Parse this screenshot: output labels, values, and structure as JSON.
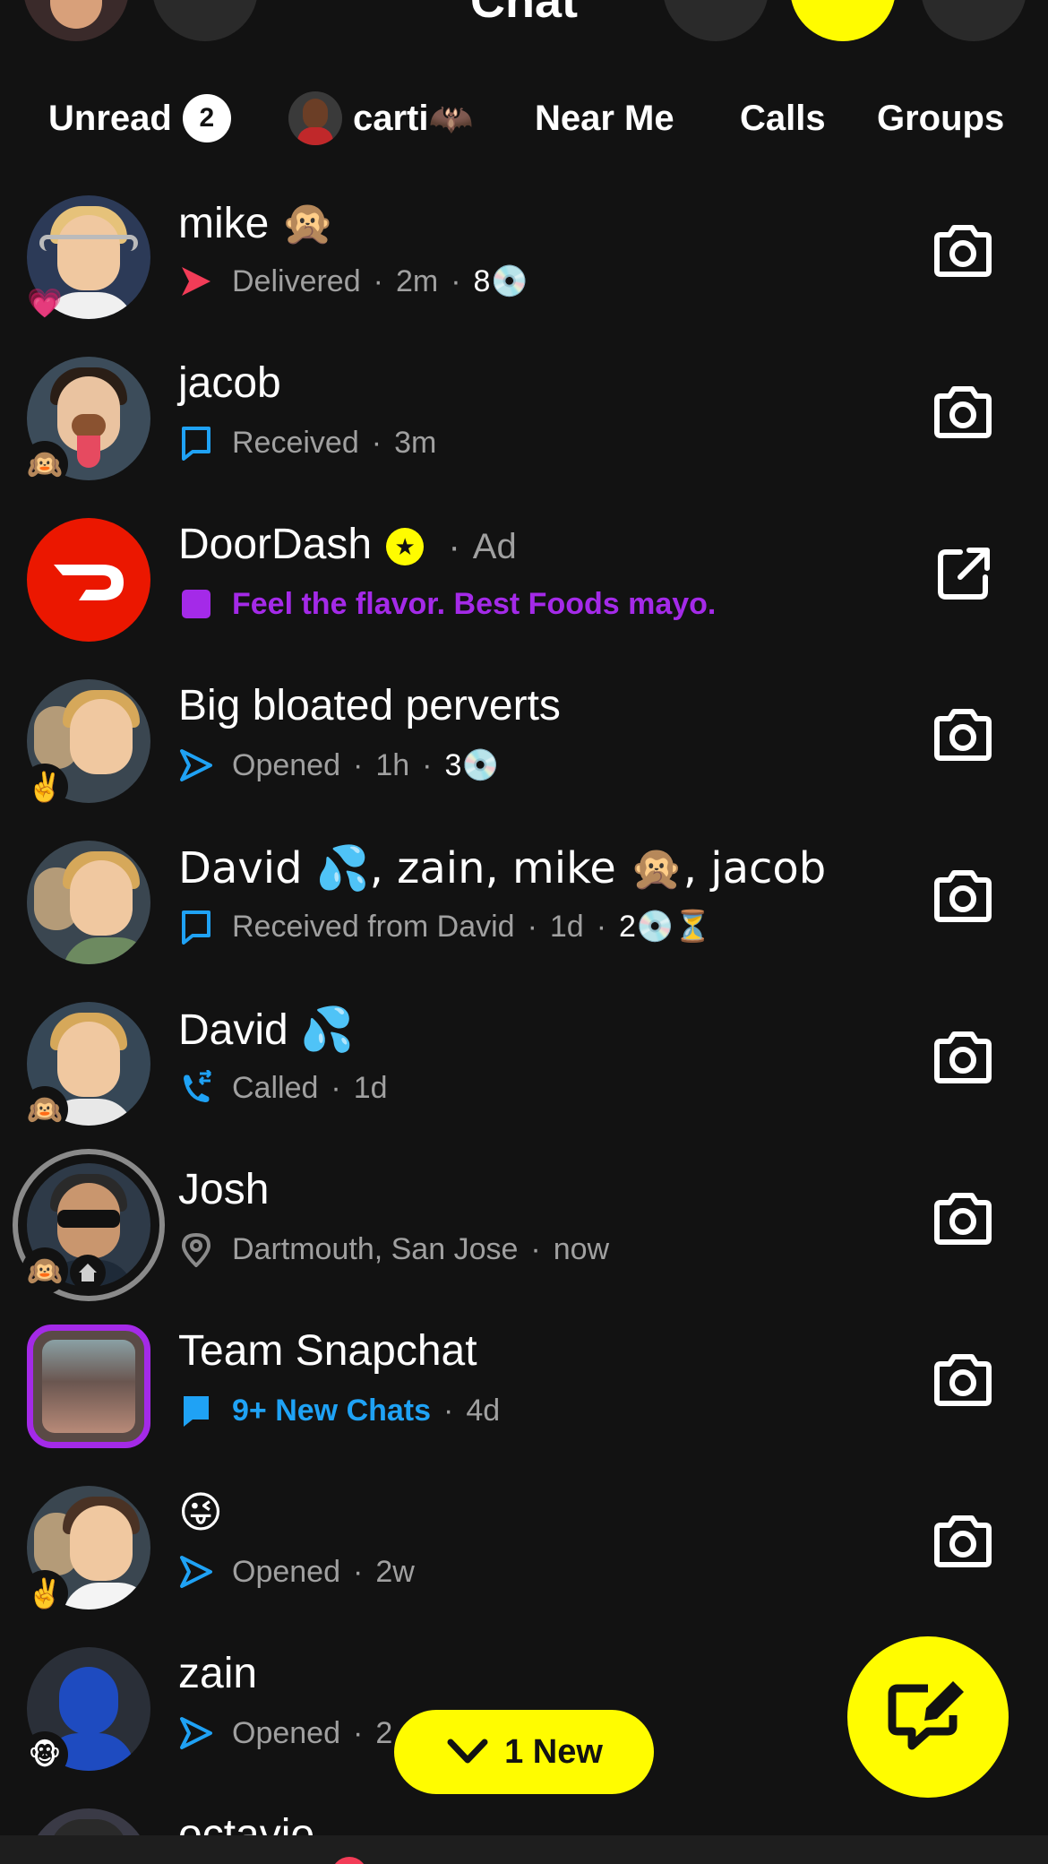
{
  "header": {
    "title": "Chat"
  },
  "tabs": [
    {
      "label": "Unread",
      "badge": "2"
    },
    {
      "label": "carti",
      "emoji": "🦇"
    },
    {
      "label": "Near Me"
    },
    {
      "label": "Calls"
    },
    {
      "label": "Groups"
    }
  ],
  "chats": [
    {
      "name": "mike",
      "name_emoji": "🙊",
      "sub_emoji": "💗",
      "status_icon": "delivered-arrow-icon",
      "status": "Delivered",
      "time": "2m",
      "streak": "8",
      "streak_emoji": "💿"
    },
    {
      "name": "jacob",
      "sub_emoji": "🙉",
      "status_icon": "received-chat-icon",
      "status": "Received",
      "time": "3m"
    },
    {
      "name": "DoorDash",
      "ad_label": "Ad",
      "status_icon": "ad-square-icon",
      "status": "Feel the flavor. Best Foods mayo."
    },
    {
      "name": "Big bloated perverts",
      "sub_emoji": "✌️",
      "status_icon": "opened-arrow-icon",
      "status": "Opened",
      "time": "1h",
      "streak": "3",
      "streak_emoji": "💿"
    },
    {
      "name": "David 💦, zain, mike 🙊, jacob",
      "status_icon": "received-chat-icon",
      "status": "Received from David",
      "time": "1d",
      "streak": "2",
      "streak_emoji": "💿⏳"
    },
    {
      "name": "David",
      "name_emoji": "💦",
      "sub_emoji": "🙉",
      "status_icon": "call-icon",
      "status": "Called",
      "time": "1d"
    },
    {
      "name": "Josh",
      "sub_emoji": "🙉",
      "status_icon": "location-pin-icon",
      "status": "Dartmouth, San Jose",
      "time": "now"
    },
    {
      "name": "Team Snapchat",
      "status_icon": "new-chat-filled-icon",
      "status": "9+ New Chats",
      "time": "4d"
    },
    {
      "name": "😜",
      "sub_emoji": "✌️",
      "status_icon": "opened-arrow-icon",
      "status": "Opened",
      "time": "2w"
    },
    {
      "name": "zain",
      "sub_emoji": "🐵",
      "status_icon": "opened-arrow-icon",
      "status": "Opened",
      "time": "2"
    },
    {
      "name": "octavio"
    }
  ],
  "new_pill": {
    "label": "1 New"
  },
  "colors": {
    "background": "#121212",
    "snap_yellow": "#fffc00",
    "sent_red": "#f23c57",
    "chat_blue": "#1fa2f5",
    "ad_purple": "#a42ae8",
    "muted_text": "#a0a0a0"
  }
}
